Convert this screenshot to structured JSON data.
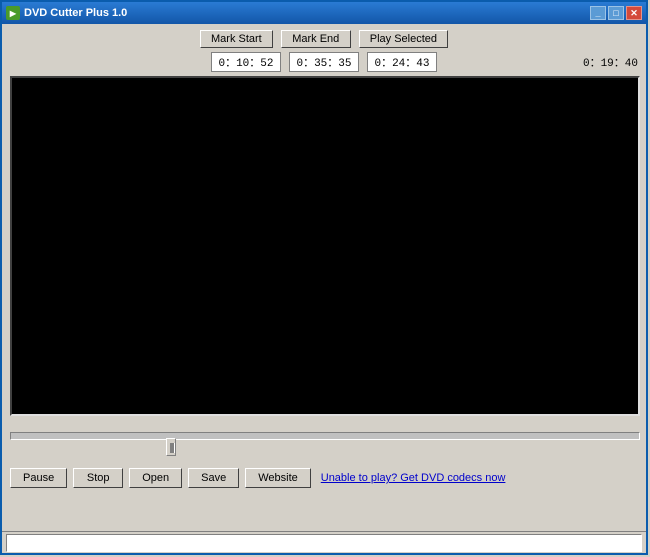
{
  "window": {
    "title": "DVD Cutter Plus 1.0",
    "icon": "▶"
  },
  "titlebar_buttons": {
    "minimize": "_",
    "maximize": "□",
    "close": "✕"
  },
  "controls": {
    "mark_start_label": "Mark Start",
    "mark_end_label": "Mark End",
    "play_selected_label": "Play Selected"
  },
  "times": {
    "mark_start_time": "0：10：52",
    "mark_end_time": "0：35：35",
    "selected_duration": "0：24：43",
    "total_time": "0：19：40"
  },
  "bottom_buttons": {
    "pause": "Pause",
    "stop": "Stop",
    "open": "Open",
    "save": "Save",
    "website": "Website"
  },
  "link": {
    "text": "Unable to play? Get DVD codecs now"
  },
  "status": {
    "text": ""
  }
}
